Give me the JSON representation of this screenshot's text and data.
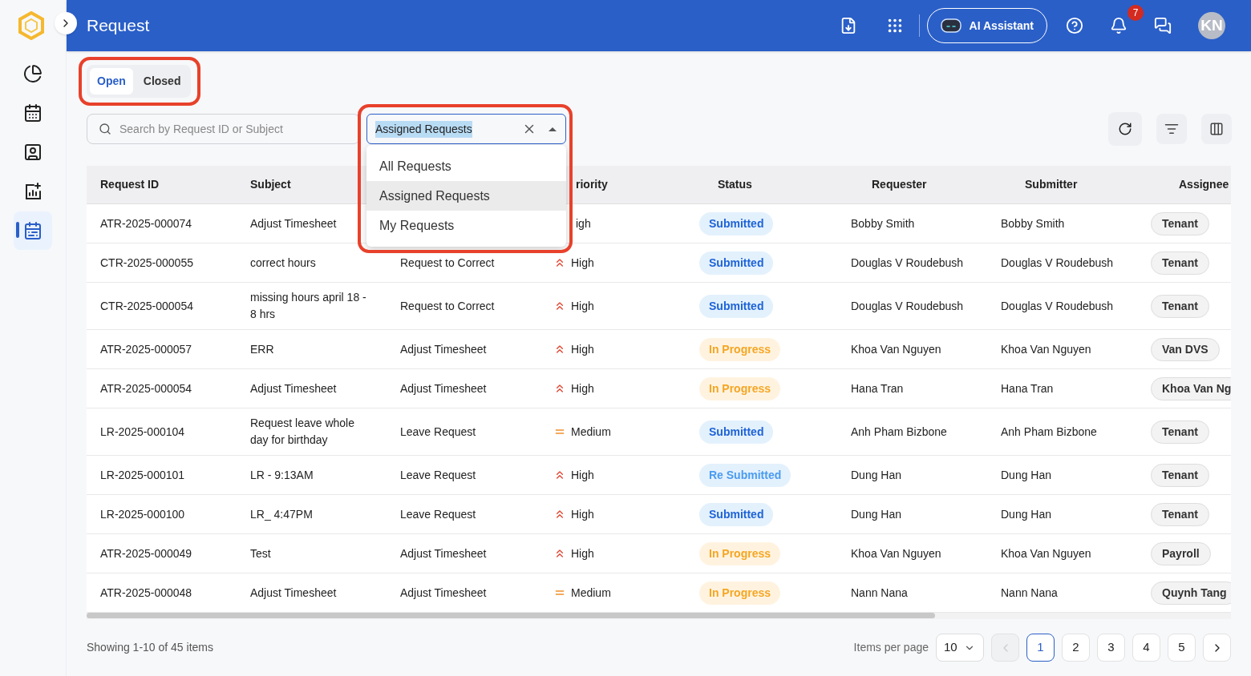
{
  "header": {
    "title": "Request",
    "ai_button": "AI Assistant",
    "notification_count": "7",
    "avatar": "KN"
  },
  "sidebar": {
    "items": [
      {
        "kind": "pie",
        "selected": false
      },
      {
        "kind": "calendar",
        "selected": false
      },
      {
        "kind": "profile",
        "selected": false
      },
      {
        "kind": "chart",
        "selected": false
      },
      {
        "kind": "list",
        "selected": true
      }
    ]
  },
  "tabs": [
    {
      "label": "Open",
      "selected": true
    },
    {
      "label": "Closed",
      "selected": false
    }
  ],
  "search": {
    "placeholder": "Search by Request ID or Subject"
  },
  "filter": {
    "value": "Assigned Requests",
    "options": [
      {
        "label": "All Requests",
        "selected": false
      },
      {
        "label": "Assigned Requests",
        "selected": true
      },
      {
        "label": "My Requests",
        "selected": false
      }
    ]
  },
  "table": {
    "columns": [
      "Request ID",
      "Subject",
      "",
      "riority",
      "Status",
      "Requester",
      "Submitter",
      "Assignee"
    ],
    "rows": [
      {
        "id": "ATR-2025-000074",
        "subject": "Adjust Timesheet",
        "priority": {
          "text": "igh"
        },
        "status": {
          "text": "Submitted",
          "kind": "submitted"
        },
        "requester": "Bobby Smith",
        "submitter": "Bobby Smith",
        "assignee": "Tenant"
      },
      {
        "id": "CTR-2025-000055",
        "subject": "correct hours",
        "type": "Request to Correct",
        "priority": {
          "text": "High",
          "kind": "high"
        },
        "status": {
          "text": "Submitted",
          "kind": "submitted"
        },
        "requester": "Douglas V Roudebush",
        "submitter": "Douglas V Roudebush",
        "assignee": "Tenant"
      },
      {
        "id": "CTR-2025-000054",
        "subject": "missing hours april 18 - 8 hrs",
        "type": "Request to Correct",
        "priority": {
          "text": "High",
          "kind": "high"
        },
        "status": {
          "text": "Submitted",
          "kind": "submitted"
        },
        "requester": "Douglas V Roudebush",
        "submitter": "Douglas V Roudebush",
        "assignee": "Tenant"
      },
      {
        "id": "ATR-2025-000057",
        "subject": "ERR",
        "type": "Adjust Timesheet",
        "priority": {
          "text": "High",
          "kind": "high"
        },
        "status": {
          "text": "In Progress",
          "kind": "in_progress"
        },
        "requester": "Khoa Van Nguyen",
        "submitter": "Khoa Van Nguyen",
        "assignee": "Van DVS"
      },
      {
        "id": "ATR-2025-000054",
        "subject": "Adjust Timesheet",
        "type": "Adjust Timesheet",
        "priority": {
          "text": "High",
          "kind": "high"
        },
        "status": {
          "text": "In Progress",
          "kind": "in_progress"
        },
        "requester": "Hana Tran",
        "submitter": "Hana Tran",
        "assignee": "Khoa Van Ng"
      },
      {
        "id": "LR-2025-000104",
        "subject": "Request leave whole day for birthday",
        "type": "Leave Request",
        "priority": {
          "text": "Medium",
          "kind": "medium"
        },
        "status": {
          "text": "Submitted",
          "kind": "submitted"
        },
        "requester": "Anh Pham Bizbone",
        "submitter": "Anh Pham Bizbone",
        "assignee": "Tenant"
      },
      {
        "id": "LR-2025-000101",
        "subject": "LR - 9:13AM",
        "type": "Leave Request",
        "priority": {
          "text": "High",
          "kind": "high"
        },
        "status": {
          "text": "Re Submitted",
          "kind": "resubmitted"
        },
        "requester": "Dung Han",
        "submitter": "Dung Han",
        "assignee": "Tenant"
      },
      {
        "id": "LR-2025-000100",
        "subject": "LR_ 4:47PM",
        "type": "Leave Request",
        "priority": {
          "text": "High",
          "kind": "high"
        },
        "status": {
          "text": "Submitted",
          "kind": "submitted"
        },
        "requester": "Dung Han",
        "submitter": "Dung Han",
        "assignee": "Tenant"
      },
      {
        "id": "ATR-2025-000049",
        "subject": "Test",
        "type": "Adjust Timesheet",
        "priority": {
          "text": "High",
          "kind": "high"
        },
        "status": {
          "text": "In Progress",
          "kind": "in_progress"
        },
        "requester": "Khoa Van Nguyen",
        "submitter": "Khoa Van Nguyen",
        "assignee": "Payroll"
      },
      {
        "id": "ATR-2025-000048",
        "subject": "Adjust Timesheet",
        "type": "Adjust Timesheet",
        "priority": {
          "text": "Medium",
          "kind": "medium"
        },
        "status": {
          "text": "In Progress",
          "kind": "in_progress"
        },
        "requester": "Nann Nana",
        "submitter": "Nann Nana",
        "assignee": "Quynh Tang"
      }
    ]
  },
  "footer": {
    "summary": "Showing 1-10 of 45 items",
    "per_page_label": "Items per page",
    "per_page": "10",
    "prev_disabled": true,
    "pages": [
      {
        "label": "1",
        "selected": true
      },
      {
        "label": "2",
        "selected": false
      },
      {
        "label": "3",
        "selected": false
      },
      {
        "label": "4",
        "selected": false
      },
      {
        "label": "5",
        "selected": false
      }
    ]
  }
}
